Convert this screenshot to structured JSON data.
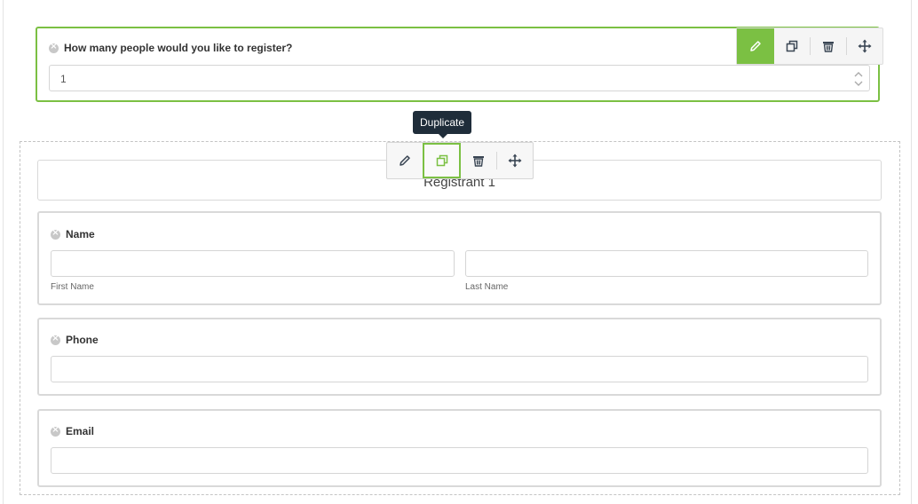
{
  "question_field": {
    "label": "How many people would you like to register?",
    "value": "1"
  },
  "toolbar": {
    "active_tool": "edit",
    "hovered_tool": "duplicate",
    "tooltip": "Duplicate",
    "icons": [
      "pencil-icon",
      "duplicate-icon",
      "trash-icon",
      "move-icon"
    ]
  },
  "section": {
    "heading": "Registrant 1",
    "fields": {
      "name": {
        "label": "Name",
        "first_sublabel": "First Name",
        "last_sublabel": "Last Name"
      },
      "phone": {
        "label": "Phone"
      },
      "email": {
        "label": "Email"
      }
    }
  },
  "colors": {
    "accent": "#7bc043",
    "tooltip_bg": "#1f2d3a",
    "border": "#d9d9d9"
  }
}
